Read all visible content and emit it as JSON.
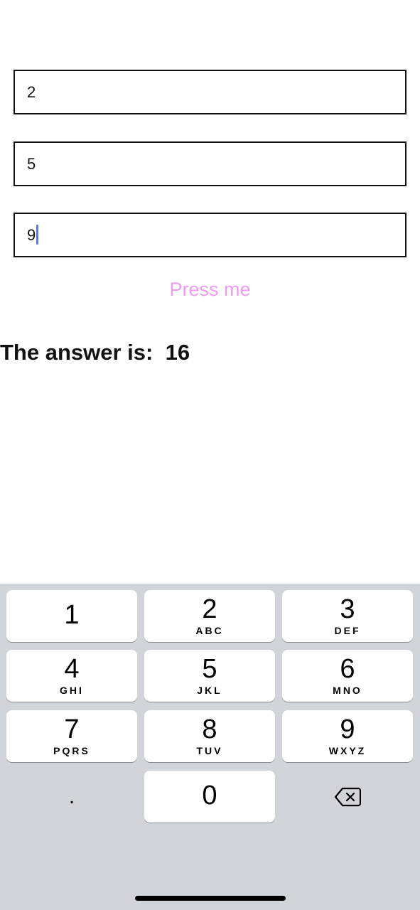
{
  "inputs": {
    "first_value": "2",
    "second_value": "5",
    "third_value": "9"
  },
  "press_button": {
    "label": "Press me",
    "color": "#ef9bef"
  },
  "result": {
    "text": "The answer is:  16"
  },
  "keypad": {
    "keys": [
      {
        "digit": "1",
        "letters": ""
      },
      {
        "digit": "2",
        "letters": "ABC"
      },
      {
        "digit": "3",
        "letters": "DEF"
      },
      {
        "digit": "4",
        "letters": "GHI"
      },
      {
        "digit": "5",
        "letters": "JKL"
      },
      {
        "digit": "6",
        "letters": "MNO"
      },
      {
        "digit": "7",
        "letters": "PQRS"
      },
      {
        "digit": "8",
        "letters": "TUV"
      },
      {
        "digit": "9",
        "letters": "WXYZ"
      },
      {
        "digit": "0",
        "letters": ""
      }
    ],
    "decimal_label": ".",
    "delete_icon": "backspace-icon"
  },
  "colors": {
    "keyboard_background": "#d1d4d9",
    "caret": "#4f7df0"
  }
}
